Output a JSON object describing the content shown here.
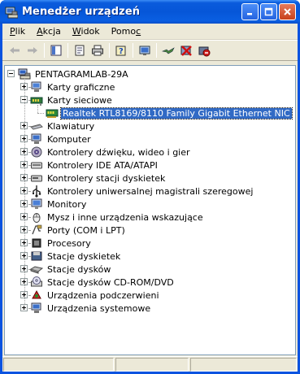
{
  "window": {
    "title": "Menedżer urządzeń"
  },
  "menu": [
    {
      "pre": "",
      "u": "P",
      "post": "lik"
    },
    {
      "pre": "",
      "u": "A",
      "post": "kcja"
    },
    {
      "pre": "",
      "u": "W",
      "post": "idok"
    },
    {
      "pre": "Pomo",
      "u": "c",
      "post": ""
    }
  ],
  "toolbar": {
    "icons": [
      "back-icon",
      "forward-icon",
      "show-hide-tree-icon",
      "properties-icon",
      "print-icon",
      "help-icon",
      "scan-hardware-icon",
      "update-driver-icon",
      "uninstall-icon",
      "disable-icon"
    ]
  },
  "tree": {
    "root": "PENTAGRAMLAB-29A",
    "items": [
      {
        "label": "Karty graficzne",
        "icon": "display-adapter-icon",
        "expanded": false
      },
      {
        "label": "Karty sieciowe",
        "icon": "network-adapter-icon",
        "expanded": true,
        "children": [
          {
            "label": "Realtek RTL8169/8110 Family Gigabit Ethernet NIC",
            "icon": "network-card-icon",
            "selected": true
          }
        ]
      },
      {
        "label": "Klawiatury",
        "icon": "keyboard-icon",
        "expanded": false
      },
      {
        "label": "Komputer",
        "icon": "computer-icon",
        "expanded": false
      },
      {
        "label": "Kontrolery dźwięku, wideo i gier",
        "icon": "sound-icon",
        "expanded": false
      },
      {
        "label": "Kontrolery IDE ATA/ATAPI",
        "icon": "ide-controller-icon",
        "expanded": false
      },
      {
        "label": "Kontrolery stacji dyskietek",
        "icon": "floppy-controller-icon",
        "expanded": false
      },
      {
        "label": "Kontrolery uniwersalnej magistrali szeregowej",
        "icon": "usb-icon",
        "expanded": false
      },
      {
        "label": "Monitory",
        "icon": "monitor-icon",
        "expanded": false
      },
      {
        "label": "Mysz i inne urządzenia wskazujące",
        "icon": "mouse-icon",
        "expanded": false
      },
      {
        "label": "Porty (COM i LPT)",
        "icon": "port-icon",
        "expanded": false
      },
      {
        "label": "Procesory",
        "icon": "processor-icon",
        "expanded": false
      },
      {
        "label": "Stacje dyskietek",
        "icon": "floppy-drive-icon",
        "expanded": false
      },
      {
        "label": "Stacje dysków",
        "icon": "disk-drive-icon",
        "expanded": false
      },
      {
        "label": "Stacje dysków CD-ROM/DVD",
        "icon": "cdrom-icon",
        "expanded": false
      },
      {
        "label": "Urządzenia podczerwieni",
        "icon": "infrared-icon",
        "expanded": false
      },
      {
        "label": "Urządzenia systemowe",
        "icon": "system-device-icon",
        "expanded": false
      }
    ]
  },
  "colors": {
    "titlebar": "#0a5bdc",
    "selection": "#316ac5",
    "chrome": "#ece9d8"
  }
}
